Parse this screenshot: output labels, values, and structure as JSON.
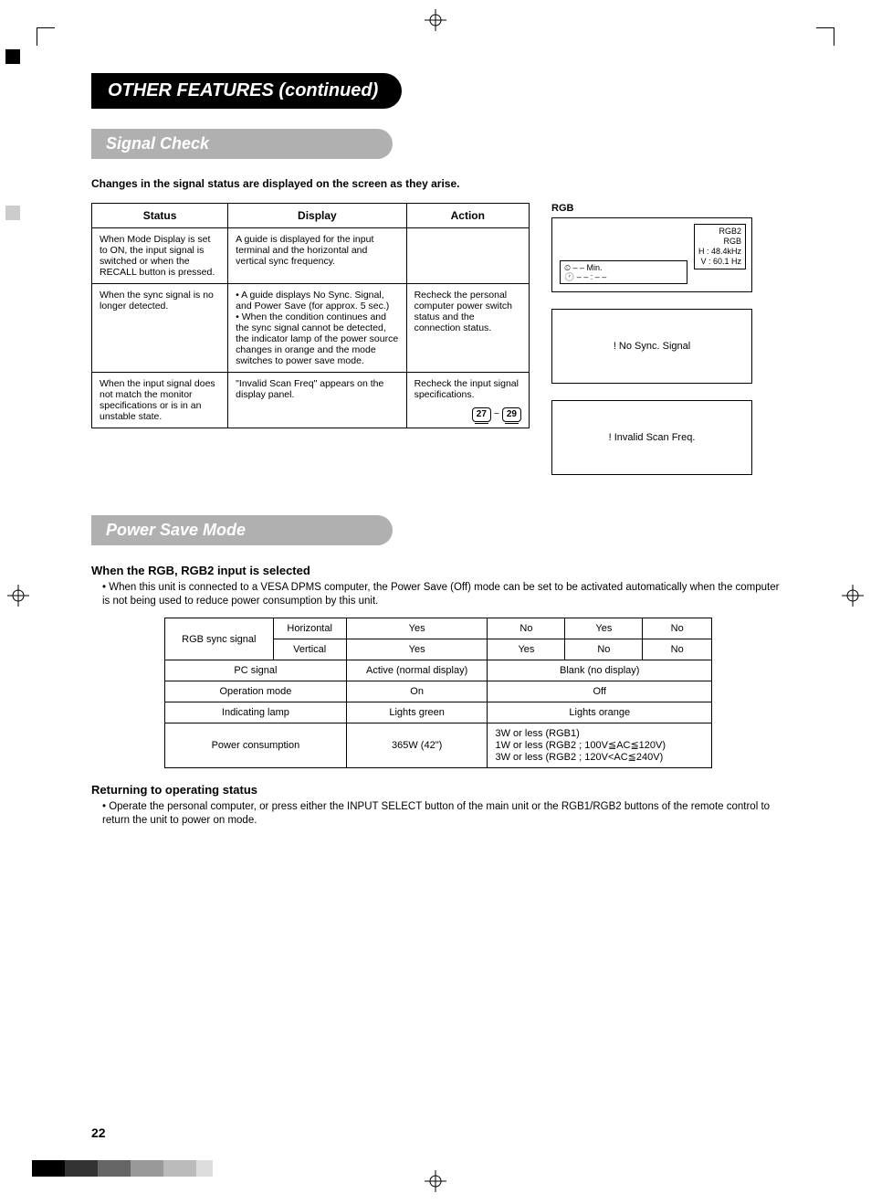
{
  "title": "OTHER FEATURES (continued)",
  "sections": {
    "signal_check": {
      "heading": "Signal Check",
      "lead": "Changes in the signal status are displayed on the screen as they arise.",
      "table": {
        "headers": [
          "Status",
          "Display",
          "Action"
        ],
        "rows": [
          {
            "status": "When Mode Display is set to ON, the input signal is switched or when the RECALL button is pressed.",
            "display": "A guide is displayed for the input terminal and the horizontal and vertical sync frequency.",
            "action": ""
          },
          {
            "status": "When the sync signal is no longer detected.",
            "display": "• A guide displays No Sync. Signal, and Power Save (for approx. 5 sec.)\n• When the condition continues and the sync signal cannot be detected, the indicator lamp of the power source changes in orange and the mode switches to power save mode.",
            "action": "Recheck the personal computer power switch status and the connection status."
          },
          {
            "status": "When the input signal does not match the monitor specifications or is in an unstable state.",
            "display": "\"Invalid Scan Freq\" appears on the display panel.",
            "action": "Recheck the input signal specifications.",
            "ref1": "27",
            "tilde": "~",
            "ref2": "29"
          }
        ]
      },
      "osd": {
        "label": "RGB",
        "box1": {
          "lines": [
            "RGB2",
            "RGB",
            "H :  48.4kHz",
            "V :  60.1 Hz"
          ],
          "clock1": "⏲   – – Min.",
          "clock2": "🕐  – – : – –"
        },
        "box2": "! No Sync. Signal",
        "box3": "! Invalid Scan Freq."
      }
    },
    "power_save": {
      "heading": "Power Save Mode",
      "sub1_title": "When the RGB, RGB2 input is selected",
      "sub1_text": "• When this unit is connected to a VESA DPMS computer, the Power Save (Off) mode can be set to be activated automatically when the computer is not being used to reduce power consumption by this unit.",
      "table": {
        "r1": {
          "c0": "RGB sync signal",
          "c1": "Horizontal",
          "c2": "Yes",
          "c3": "No",
          "c4": "Yes",
          "c5": "No"
        },
        "r2": {
          "c1": "Vertical",
          "c2": "Yes",
          "c3": "Yes",
          "c4": "No",
          "c5": "No"
        },
        "r3": {
          "c0": "PC signal",
          "c1": "Active (normal display)",
          "c2": "Blank (no display)"
        },
        "r4": {
          "c0": "Operation mode",
          "c1": "On",
          "c2": "Off"
        },
        "r5": {
          "c0": "Indicating lamp",
          "c1": "Lights green",
          "c2": "Lights orange"
        },
        "r6": {
          "c0": "Power consumption",
          "c1": "365W (42\")",
          "c2a": "3W or less (RGB1)",
          "c2b": "1W or less (RGB2 ; 100V≦AC≦120V)",
          "c2c": "3W or less (RGB2 ; 120V<AC≦240V)"
        }
      },
      "sub2_title": "Returning to operating status",
      "sub2_text": "• Operate the personal computer, or press either the INPUT SELECT button of the main unit or the RGB1/RGB2 buttons of the remote control to return the unit to power on mode."
    }
  },
  "page_number": "22"
}
